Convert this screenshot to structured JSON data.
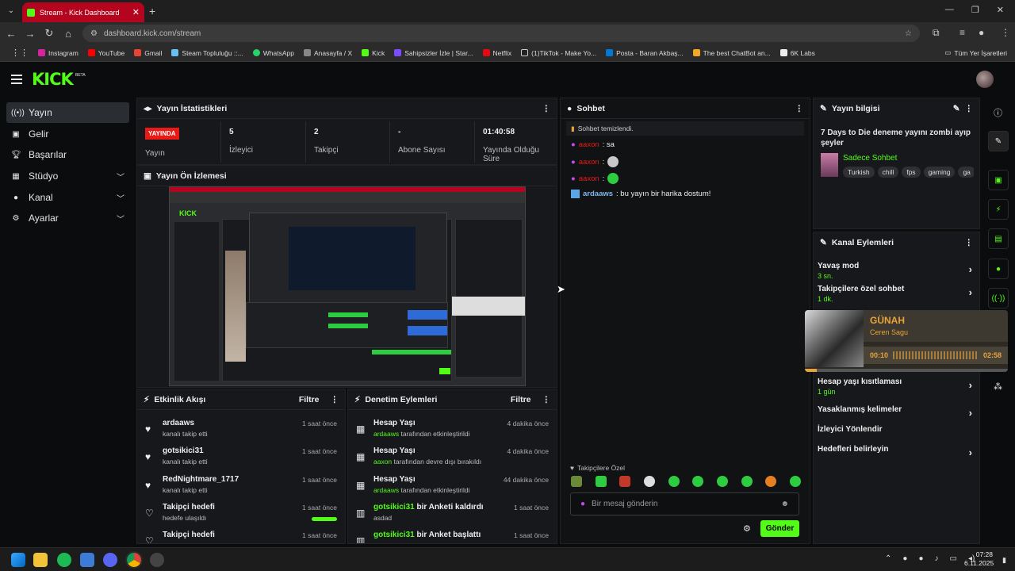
{
  "browser": {
    "tab_title": "Stream - Kick Dashboard",
    "url": "dashboard.kick.com/stream",
    "new_tab": "+",
    "bookmarks": [
      "Instagram",
      "YouTube",
      "Gmail",
      "Steam Topluluğu ::...",
      "WhatsApp",
      "Anasayfa / X",
      "Kick",
      "Sahipsizler İzle | Star...",
      "Netflix",
      "(1)TikTok - Make Yo...",
      "Posta - Baran Akbaş...",
      "The best ChatBot an...",
      "6K Labs"
    ],
    "all_bookmarks": "Tüm Yer İşaretleri"
  },
  "brand": {
    "logo": "KICK",
    "beta": "BETA",
    "accent": "#53fc18"
  },
  "sidebar": {
    "items": [
      {
        "label": "Yayın",
        "icon": "broadcast-icon"
      },
      {
        "label": "Gelir",
        "icon": "wallet-icon"
      },
      {
        "label": "Başarılar",
        "icon": "trophy-icon"
      },
      {
        "label": "Stüdyo",
        "icon": "studio-icon"
      },
      {
        "label": "Kanal",
        "icon": "user-icon"
      },
      {
        "label": "Ayarlar",
        "icon": "gear-icon"
      }
    ]
  },
  "stats": {
    "title": "Yayın İstatistikleri",
    "live_badge": "YAYINDA",
    "live_label": "Yayın",
    "viewers_value": "5",
    "viewers_label": "İzleyici",
    "followers_value": "2",
    "followers_label": "Takipçi",
    "subs_value": "-",
    "subs_label": "Abone Sayısı",
    "duration_value": "01:40:58",
    "duration_label": "Yayında Olduğu Süre"
  },
  "preview": {
    "title": "Yayın Ön İzlemesi"
  },
  "activity": {
    "title": "Etkinlik Akışı",
    "filter": "Filtre",
    "items": [
      {
        "name": "ardaaws",
        "desc": "kanalı takip etti",
        "time": "1 saat önce",
        "icon": "heart-icon"
      },
      {
        "name": "gotsikici31",
        "desc": "kanalı takip etti",
        "time": "1 saat önce",
        "icon": "heart-icon"
      },
      {
        "name": "RedNightmare_1717",
        "desc": "kanalı takip etti",
        "time": "1 saat önce",
        "icon": "heart-icon"
      },
      {
        "name": "Takipçi hedefi",
        "desc": "hedefe ulaşıldı",
        "time": "1 saat önce",
        "icon": "heart-outline-icon"
      },
      {
        "name": "Takipçi hedefi",
        "desc": "",
        "time": "1 saat önce",
        "icon": "heart-outline-icon"
      }
    ]
  },
  "moderation": {
    "title": "Denetim Eylemleri",
    "filter": "Filtre",
    "items": [
      {
        "title": "Hesap Yaşı",
        "user": "ardaaws",
        "desc": "tarafından etkinleştirildi",
        "time": "4 dakika önce"
      },
      {
        "title": "Hesap Yaşı",
        "user": "aaxon",
        "desc": "tarafından devre dışı bırakıldı",
        "time": "4 dakika önce"
      },
      {
        "title": "Hesap Yaşı",
        "user": "ardaaws",
        "desc": "tarafından etkinleştirildi",
        "time": "44 dakika önce"
      },
      {
        "title": "bir Anketi kaldırdı",
        "user": "gotsikici31",
        "desc": "asdad",
        "time": "1 saat önce"
      },
      {
        "title": "bir Anket başlattı",
        "user": "gotsikici31",
        "desc": "",
        "time": "1 saat önce"
      }
    ]
  },
  "chat": {
    "title": "Sohbet",
    "cleared": "Sohbet temizlendi.",
    "messages": [
      {
        "user": "aaxon",
        "text": ": sa"
      },
      {
        "user": "aaxon",
        "text": ":"
      },
      {
        "user": "aaxon",
        "text": ":"
      },
      {
        "user": "ardaaws",
        "text": ": bu yayın bir harika dostum!"
      }
    ],
    "followers_only": "Takipçilere Özel",
    "placeholder": "Bir mesaj gönderin",
    "send": "Gönder"
  },
  "stream_info": {
    "title": "Yayın bilgisi",
    "stream_title": "7 Days to Die deneme yayını zombi ayıp şeyler",
    "category": "Sadece Sohbet",
    "tags": [
      "Turkish",
      "chill",
      "fps",
      "gaming",
      "ga"
    ]
  },
  "channel_actions": {
    "title": "Kanal Eylemleri",
    "items": [
      {
        "label": "Yavaş mod",
        "sub": "3 sn."
      },
      {
        "label": "Takipçilere özel sohbet",
        "sub": "1 dk."
      },
      {
        "label": "Hesap yaşı kısıtlaması",
        "sub": "1 gün"
      },
      {
        "label": "Yasaklanmış kelimeler",
        "sub": ""
      },
      {
        "label": "İzleyici Yönlendir",
        "sub": ""
      },
      {
        "label": "Hedefleri belirleyin",
        "sub": ""
      }
    ]
  },
  "music": {
    "title": "GÜNAH",
    "artist": "Ceren Sagu",
    "elapsed": "00:10",
    "total": "02:58",
    "progress": 0.06
  },
  "taskbar": {
    "time": "07:28",
    "date": "6.11.2025"
  }
}
